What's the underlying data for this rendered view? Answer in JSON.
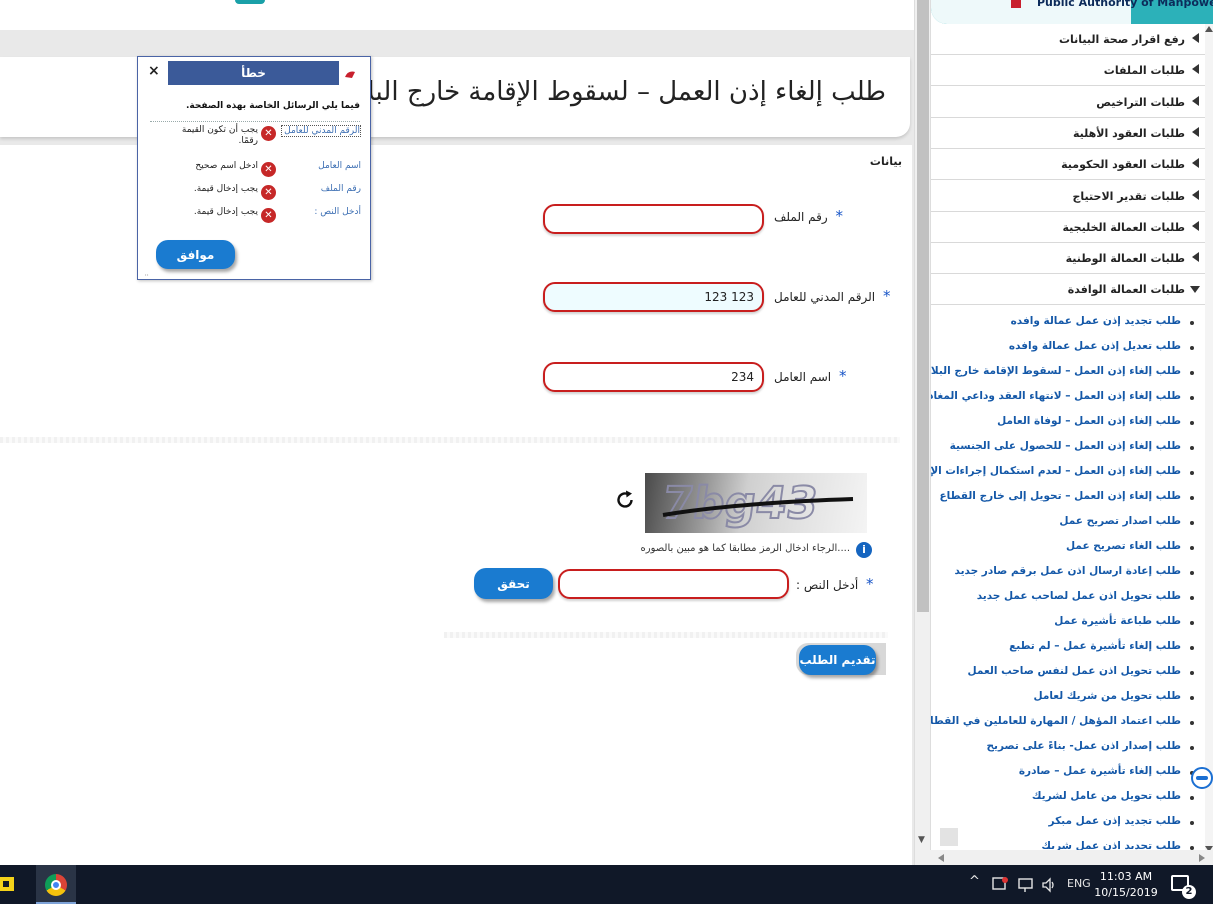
{
  "header": {
    "org_name": "Public Authority of Manpower"
  },
  "page": {
    "title": "طلب إلغاء إذن العمل – لسقوط الإقامة خارج البلاد",
    "section_label": "بيانات"
  },
  "form": {
    "file_number": {
      "label": "رقم الملف",
      "required_mark": "*",
      "value": ""
    },
    "civil_id": {
      "label": "الرقم المدني للعامل",
      "required_mark": "*",
      "value": "123 123"
    },
    "worker_name": {
      "label": "اسم العامل",
      "required_mark": "*",
      "value": "234"
    },
    "captcha": {
      "text": "7bg43",
      "hint": "....الرجاء ادخال الرمز مطابقا كما هو مبين بالصوره",
      "input_label": "أدخل النص :",
      "required_mark": "*",
      "value": "",
      "verify_button": "تحقق"
    },
    "submit_button": "تقديم الطلب"
  },
  "error_dialog": {
    "title": "خطأ",
    "close_symbol": "×",
    "intro": "فيما يلي الرسائل الخاصة بهذه الصفحة.",
    "errors": [
      {
        "field": "الرقم المدني للعامل",
        "message": "يجب أن تكون القيمة رقمًا."
      },
      {
        "field": "اسم العامل",
        "message": "ادخل اسم صحيح"
      },
      {
        "field": "رقم الملف",
        "message": "يجب إدخال قيمة."
      },
      {
        "field": "أدخل النص :",
        "message": "يجب إدخال قيمة."
      }
    ],
    "ok_button": "موافق"
  },
  "sidebar": {
    "categories": [
      {
        "label": "رفع اقرار صحة البيانات",
        "expanded": false
      },
      {
        "label": "طلبات الملفات",
        "expanded": false
      },
      {
        "label": "طلبات التراخيص",
        "expanded": false
      },
      {
        "label": "طلبات العقود الأهلية",
        "expanded": false
      },
      {
        "label": "طلبات العقود الحكومية",
        "expanded": false
      },
      {
        "label": "طلبات تقدير الاحتياج",
        "expanded": false
      },
      {
        "label": "طلبات العمالة الخليجية",
        "expanded": false
      },
      {
        "label": "طلبات العمالة الوطنية",
        "expanded": false
      },
      {
        "label": "طلبات العمالة الوافدة",
        "expanded": true
      }
    ],
    "links": [
      "طلب تجديد إذن عمل عمالة وافده",
      "طلب تعديل إذن عمل عمالة وافده",
      "طلب إلغاء إذن العمل – لسقوط الإقامة خارج البلاد",
      "طلب إلغاء إذن العمل – لانتهاء العقد وداعي المغادرة",
      "طلب إلغاء إذن العمل – لوفاة العامل",
      "طلب إلغاء إذن العمل – للحصول على الجنسية",
      "طلب إلغاء إذن العمل – لعدم استكمال إجراءات الإقامة",
      "طلب إلغاء إذن العمل – تحويل إلى خارج القطاع",
      "طلب اصدار تصريح عمل",
      "طلب الغاء تصريح عمل",
      "طلب إعادة ارسال اذن عمل برقم صادر جديد",
      "طلب تحويل اذن عمل لصاحب عمل جديد",
      "طلب طباعة تأشيرة عمل",
      "طلب إلغاء تأشيرة عمل – لم تطبع",
      "طلب تحويل اذن عمل لنفس صاحب العمل",
      "طلب تحويل من شريك لعامل",
      "طلب اعتماد المؤهل / المهارة للعاملين في القطاع",
      "طلب إصدار اذن عمل- بناءً على تصريح",
      "طلب إلغاء تأشيرة عمل – صادرة",
      "طلب تحويل من عامل لشريك",
      "طلب تجديد إذن عمل مبكر",
      "طلب تجديد اذن عمل شريك"
    ]
  },
  "taskbar": {
    "language": "ENG",
    "time": "11:03 AM",
    "date": "10/15/2019",
    "notification_count": "2",
    "tray_chevron": "^"
  },
  "colors": {
    "accent_blue": "#1a7bd0",
    "error_red": "#c81e1e",
    "dialog_header": "#3b5a99",
    "link_blue": "#1458a8",
    "header_teal": "#2cb1b9"
  }
}
